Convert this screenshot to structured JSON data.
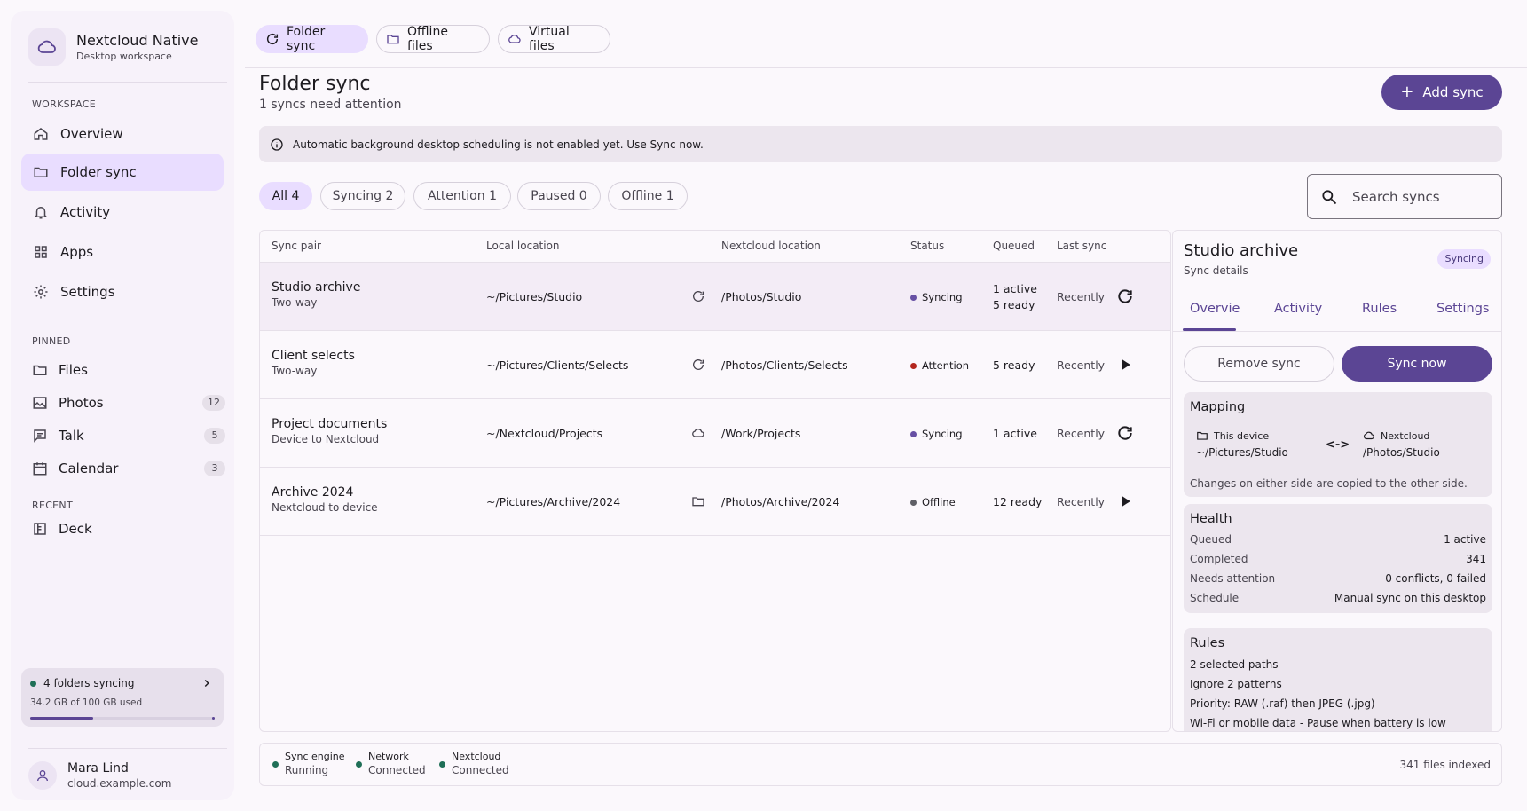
{
  "app": {
    "title": "Nextcloud Native",
    "subtitle": "Desktop workspace"
  },
  "sidebar": {
    "workspace_label": "WORKSPACE",
    "nav": [
      {
        "label": "Overview",
        "icon": "home-icon"
      },
      {
        "label": "Folder sync",
        "icon": "folder-icon",
        "active": true
      },
      {
        "label": "Activity",
        "icon": "bell-icon"
      },
      {
        "label": "Apps",
        "icon": "apps-grid-icon"
      },
      {
        "label": "Settings",
        "icon": "gear-icon"
      }
    ],
    "pinned_label": "PINNED",
    "pinned": [
      {
        "label": "Files",
        "icon": "folder-icon",
        "count": ""
      },
      {
        "label": "Photos",
        "icon": "photo-icon",
        "count": "12"
      },
      {
        "label": "Talk",
        "icon": "chat-icon",
        "count": "5"
      },
      {
        "label": "Calendar",
        "icon": "calendar-icon",
        "count": "3"
      }
    ],
    "recent_label": "RECENT",
    "recent": [
      {
        "label": "Deck",
        "icon": "deck-icon"
      }
    ],
    "storage": {
      "status": "4 folders syncing",
      "usage": "34.2 GB of 100 GB used",
      "used_fraction": 0.342
    },
    "user": {
      "name": "Mara Lind",
      "host": "cloud.example.com"
    }
  },
  "tabs": [
    {
      "label": "Folder sync",
      "icon": "refresh-icon",
      "active": true
    },
    {
      "label": "Offline files",
      "icon": "folder-icon"
    },
    {
      "label": "Virtual files",
      "icon": "cloud-icon"
    }
  ],
  "page": {
    "title": "Folder sync",
    "subtitle": "1 syncs need attention",
    "add_label": "Add sync",
    "banner": "Automatic background desktop scheduling is not enabled yet. Use Sync now."
  },
  "filters": [
    {
      "label": "All 4",
      "active": true
    },
    {
      "label": "Syncing 2"
    },
    {
      "label": "Attention 1"
    },
    {
      "label": "Paused 0"
    },
    {
      "label": "Offline 1"
    }
  ],
  "search": {
    "placeholder": "Search syncs",
    "value": ""
  },
  "table": {
    "columns": [
      "Sync pair",
      "Local location",
      "Nextcloud location",
      "Status",
      "Queued",
      "Last sync"
    ],
    "rows": [
      {
        "name": "Studio archive",
        "mode": "Two-way",
        "local": "~/Pictures/Studio",
        "mode_icon": "refresh-icon",
        "remote": "/Photos/Studio",
        "status": "Syncing",
        "status_color": "#6750a4",
        "queued1": "1 active",
        "queued2": "5 ready",
        "last": "Recently",
        "action_icon": "refresh-icon",
        "selected": true
      },
      {
        "name": "Client selects",
        "mode": "Two-way",
        "local": "~/Pictures/Clients/Selects",
        "mode_icon": "refresh-icon",
        "remote": "/Photos/Clients/Selects",
        "status": "Attention",
        "status_color": "#b3261e",
        "queued1": "5 ready",
        "queued2": "",
        "last": "Recently",
        "action_icon": "play-icon"
      },
      {
        "name": "Project documents",
        "mode": "Device to Nextcloud",
        "local": "~/Nextcloud/Projects",
        "mode_icon": "cloud-icon",
        "remote": "/Work/Projects",
        "status": "Syncing",
        "status_color": "#6750a4",
        "queued1": "1 active",
        "queued2": "",
        "last": "Recently",
        "action_icon": "refresh-icon"
      },
      {
        "name": "Archive 2024",
        "mode": "Nextcloud to device",
        "local": "~/Pictures/Archive/2024",
        "mode_icon": "folder-icon",
        "remote": "/Photos/Archive/2024",
        "status": "Offline",
        "status_color": "#5f5f66",
        "queued1": "12 ready",
        "queued2": "",
        "last": "Recently",
        "action_icon": "play-icon"
      }
    ]
  },
  "details": {
    "title": "Studio archive",
    "subtitle": "Sync details",
    "badge": "Syncing",
    "tabs": [
      "Overvie",
      "Activity",
      "Rules",
      "Settings"
    ],
    "remove_label": "Remove sync",
    "sync_label": "Sync now",
    "mapping": {
      "title": "Mapping",
      "local_head": "This device",
      "local_path": "~/Pictures/Studio",
      "arrow": "<->",
      "remote_head": "Nextcloud",
      "remote_path": "/Photos/Studio",
      "note": "Changes on either side are copied to the other side."
    },
    "health": {
      "title": "Health",
      "items": [
        {
          "k": "Queued",
          "v": "1 active"
        },
        {
          "k": "Completed",
          "v": "341"
        },
        {
          "k": "Needs attention",
          "v": "0 conflicts, 0 failed"
        },
        {
          "k": "Schedule",
          "v": "Manual sync on this desktop"
        }
      ]
    },
    "rules": {
      "title": "Rules",
      "items": [
        "2 selected paths",
        "Ignore 2 patterns",
        "Priority: RAW (.raf) then JPEG (.jpg)",
        "Wi-Fi or mobile data - Pause when battery is low"
      ]
    }
  },
  "footer": {
    "items": [
      {
        "name": "Sync engine",
        "value": "Running"
      },
      {
        "name": "Network",
        "value": "Connected"
      },
      {
        "name": "Nextcloud",
        "value": "Connected"
      }
    ],
    "indexed": "341 files indexed"
  },
  "colors": {
    "accent": "#5b4594",
    "accent_container": "#e9ddff",
    "ok": "#1f6f57",
    "attention": "#b3261e"
  }
}
